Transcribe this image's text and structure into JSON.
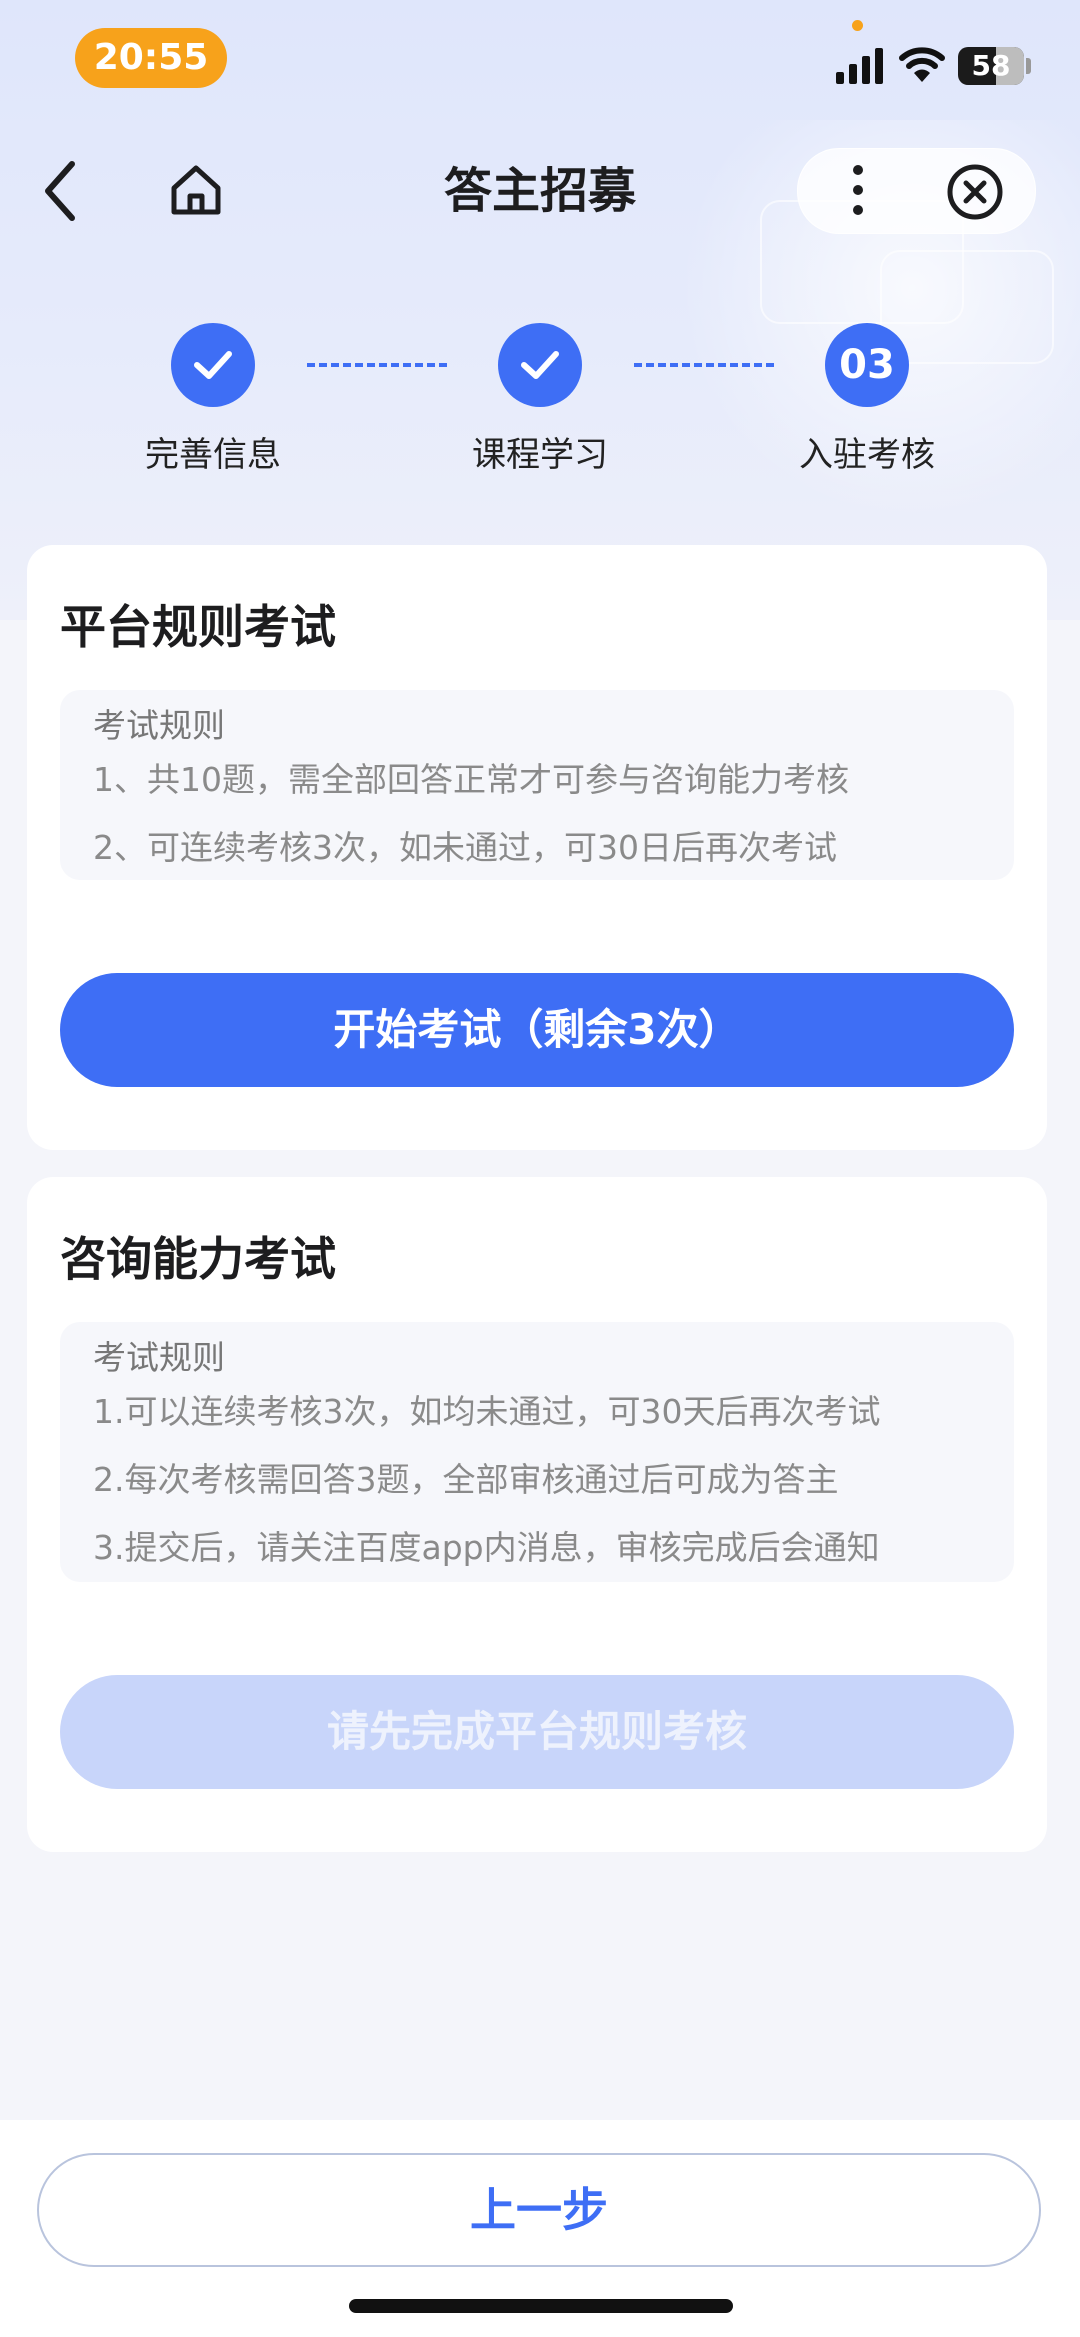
{
  "status_bar": {
    "time": "20:55",
    "battery": "58"
  },
  "nav": {
    "title": "答主招募"
  },
  "steps": [
    {
      "label": "完善信息",
      "state": "done"
    },
    {
      "label": "课程学习",
      "state": "done"
    },
    {
      "label": "入驻考核",
      "state": "current",
      "number": "03"
    }
  ],
  "platform_exam": {
    "title": "平台规则考试",
    "rules_title": "考试规则",
    "rules": [
      "1、共10题，需全部回答正常才可参与咨询能力考核",
      "2、可连续考核3次，如未通过，可30日后再次考试"
    ],
    "button": "开始考试（剩余3次）"
  },
  "consult_exam": {
    "title": "咨询能力考试",
    "rules_title": "考试规则",
    "rules": [
      "1.可以连续考核3次，如均未通过，可30天后再次考试",
      "2.每次考核需回答3题，全部审核通过后可成为答主",
      "3.提交后，请关注百度app内消息，审核完成后会通知"
    ],
    "button": "请先完成平台规则考核"
  },
  "footer": {
    "prev_button": "上一步"
  },
  "colors": {
    "primary": "#3e6ef5",
    "disabled": "#c8d5fa",
    "time_pill": "#f7a21b"
  }
}
